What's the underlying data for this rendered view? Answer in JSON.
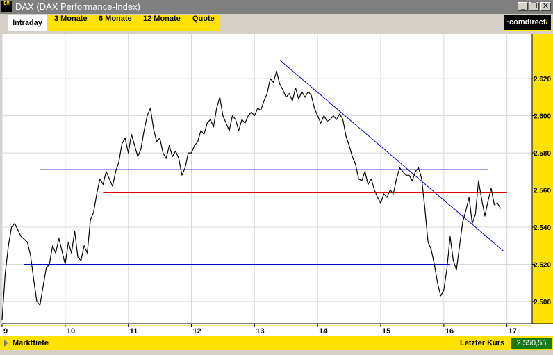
{
  "window": {
    "app_icon_text": "EM",
    "title": "DAX (DAX Performance-Index)",
    "minimize": "_",
    "restore": "❐",
    "close": "✕"
  },
  "tabs": {
    "active": "Intraday",
    "items": [
      "3 Monate",
      "6 Monate",
      "12 Monate",
      "Quote"
    ]
  },
  "brand": {
    "prefix": "·comdirect",
    "suffix": "/"
  },
  "chart_data": {
    "type": "line",
    "xlabel": "",
    "ylabel": "",
    "x_ticks": [
      "9",
      "10",
      "11",
      "12",
      "13",
      "14",
      "15",
      "16",
      "17"
    ],
    "y_ticks": [
      "2.500",
      "2.520",
      "2.540",
      "2.560",
      "2.580",
      "2.600",
      "2.620"
    ],
    "xlim": [
      9,
      17.4
    ],
    "ylim": [
      2488,
      2644
    ],
    "grid": true,
    "series": [
      {
        "color": "#000000",
        "points": [
          [
            9.0,
            2490
          ],
          [
            9.05,
            2515
          ],
          [
            9.1,
            2530
          ],
          [
            9.15,
            2540
          ],
          [
            9.2,
            2542
          ],
          [
            9.3,
            2535
          ],
          [
            9.4,
            2532
          ],
          [
            9.45,
            2525
          ],
          [
            9.5,
            2512
          ],
          [
            9.55,
            2500
          ],
          [
            9.6,
            2498
          ],
          [
            9.65,
            2508
          ],
          [
            9.7,
            2518
          ],
          [
            9.75,
            2520
          ],
          [
            9.8,
            2530
          ],
          [
            9.85,
            2526
          ],
          [
            9.9,
            2534
          ],
          [
            10.0,
            2520
          ],
          [
            10.05,
            2532
          ],
          [
            10.1,
            2526
          ],
          [
            10.15,
            2538
          ],
          [
            10.2,
            2524
          ],
          [
            10.25,
            2522
          ],
          [
            10.3,
            2530
          ],
          [
            10.35,
            2526
          ],
          [
            10.4,
            2544
          ],
          [
            10.45,
            2548
          ],
          [
            10.5,
            2558
          ],
          [
            10.55,
            2566
          ],
          [
            10.6,
            2563
          ],
          [
            10.65,
            2570
          ],
          [
            10.7,
            2566
          ],
          [
            10.75,
            2562
          ],
          [
            10.8,
            2570
          ],
          [
            10.85,
            2575
          ],
          [
            10.9,
            2585
          ],
          [
            10.95,
            2588
          ],
          [
            11.0,
            2580
          ],
          [
            11.05,
            2590
          ],
          [
            11.1,
            2584
          ],
          [
            11.15,
            2578
          ],
          [
            11.2,
            2582
          ],
          [
            11.25,
            2592
          ],
          [
            11.3,
            2600
          ],
          [
            11.35,
            2604
          ],
          [
            11.4,
            2593
          ],
          [
            11.45,
            2586
          ],
          [
            11.5,
            2588
          ],
          [
            11.55,
            2580
          ],
          [
            11.6,
            2577
          ],
          [
            11.65,
            2584
          ],
          [
            11.7,
            2578
          ],
          [
            11.75,
            2581
          ],
          [
            11.8,
            2577
          ],
          [
            11.85,
            2568
          ],
          [
            11.9,
            2572
          ],
          [
            11.95,
            2580
          ],
          [
            12.0,
            2580
          ],
          [
            12.05,
            2584
          ],
          [
            12.1,
            2586
          ],
          [
            12.15,
            2592
          ],
          [
            12.2,
            2590
          ],
          [
            12.25,
            2596
          ],
          [
            12.3,
            2598
          ],
          [
            12.35,
            2594
          ],
          [
            12.4,
            2604
          ],
          [
            12.45,
            2610
          ],
          [
            12.5,
            2600
          ],
          [
            12.55,
            2596
          ],
          [
            12.6,
            2592
          ],
          [
            12.65,
            2600
          ],
          [
            12.7,
            2598
          ],
          [
            12.75,
            2592
          ],
          [
            12.8,
            2598
          ],
          [
            12.85,
            2596
          ],
          [
            12.9,
            2600
          ],
          [
            12.95,
            2602
          ],
          [
            13.0,
            2600
          ],
          [
            13.05,
            2604
          ],
          [
            13.1,
            2603
          ],
          [
            13.15,
            2608
          ],
          [
            13.2,
            2612
          ],
          [
            13.25,
            2620
          ],
          [
            13.3,
            2618
          ],
          [
            13.35,
            2624
          ],
          [
            13.4,
            2617
          ],
          [
            13.45,
            2614
          ],
          [
            13.5,
            2610
          ],
          [
            13.55,
            2612
          ],
          [
            13.6,
            2608
          ],
          [
            13.65,
            2615
          ],
          [
            13.7,
            2609
          ],
          [
            13.75,
            2613
          ],
          [
            13.8,
            2610
          ],
          [
            13.85,
            2613
          ],
          [
            13.9,
            2611
          ],
          [
            13.95,
            2604
          ],
          [
            14.0,
            2600
          ],
          [
            14.05,
            2596
          ],
          [
            14.1,
            2600
          ],
          [
            14.15,
            2597
          ],
          [
            14.2,
            2598
          ],
          [
            14.25,
            2600
          ],
          [
            14.3,
            2598
          ],
          [
            14.35,
            2601
          ],
          [
            14.4,
            2598
          ],
          [
            14.45,
            2589
          ],
          [
            14.5,
            2584
          ],
          [
            14.55,
            2578
          ],
          [
            14.6,
            2574
          ],
          [
            14.65,
            2566
          ],
          [
            14.7,
            2565
          ],
          [
            14.75,
            2570
          ],
          [
            14.8,
            2563
          ],
          [
            14.85,
            2566
          ],
          [
            14.9,
            2560
          ],
          [
            14.95,
            2556
          ],
          [
            15.0,
            2553
          ],
          [
            15.05,
            2558
          ],
          [
            15.1,
            2556
          ],
          [
            15.15,
            2560
          ],
          [
            15.2,
            2558
          ],
          [
            15.25,
            2566
          ],
          [
            15.3,
            2572
          ],
          [
            15.35,
            2570
          ],
          [
            15.4,
            2568
          ],
          [
            15.45,
            2568
          ],
          [
            15.5,
            2565
          ],
          [
            15.55,
            2570
          ],
          [
            15.6,
            2572
          ],
          [
            15.65,
            2566
          ],
          [
            15.7,
            2550
          ],
          [
            15.75,
            2532
          ],
          [
            15.8,
            2528
          ],
          [
            15.85,
            2520
          ],
          [
            15.9,
            2510
          ],
          [
            15.95,
            2503
          ],
          [
            16.0,
            2506
          ],
          [
            16.05,
            2518
          ],
          [
            16.1,
            2535
          ],
          [
            16.15,
            2522
          ],
          [
            16.2,
            2517
          ],
          [
            16.25,
            2530
          ],
          [
            16.3,
            2543
          ],
          [
            16.35,
            2549
          ],
          [
            16.4,
            2556
          ],
          [
            16.45,
            2542
          ],
          [
            16.5,
            2547
          ],
          [
            16.55,
            2565
          ],
          [
            16.6,
            2555
          ],
          [
            16.65,
            2546
          ],
          [
            16.7,
            2554
          ],
          [
            16.75,
            2561
          ],
          [
            16.8,
            2552
          ],
          [
            16.85,
            2553
          ],
          [
            16.9,
            2550
          ]
        ]
      }
    ],
    "annotations": [
      {
        "kind": "hline",
        "color": "#0000cc",
        "y": 2571,
        "x_from": 9.6,
        "x_to": 16.7
      },
      {
        "kind": "hline",
        "color": "#dd0000",
        "y": 2558.5,
        "x_from": 10.6,
        "x_to": 17.0
      },
      {
        "kind": "hline",
        "color": "#0000cc",
        "y": 2520,
        "x_from": 9.35,
        "x_to": 16.1
      },
      {
        "kind": "hline",
        "color": "#e8e060",
        "y": 2487,
        "x_from": 9.0,
        "x_to": 17.4
      },
      {
        "kind": "trend",
        "color": "#0000cc",
        "x1": 13.4,
        "y1": 2630,
        "x2": 16.95,
        "y2": 2527
      }
    ]
  },
  "bottom": {
    "left_label": "Markttiefe",
    "last_label": "Letzter Kurs",
    "last_value": "2.550,55"
  }
}
